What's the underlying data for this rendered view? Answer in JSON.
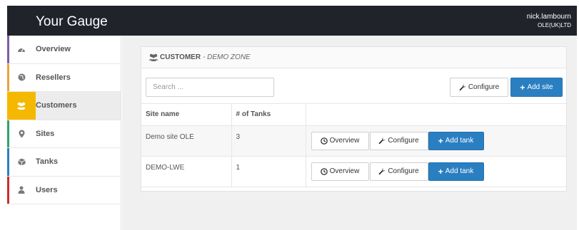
{
  "app": {
    "title": "Your Gauge"
  },
  "user": {
    "name": "nick.lambourn",
    "org": "OLE(UK)LTD"
  },
  "sidebar": {
    "items": [
      {
        "label": "Overview",
        "icon": "dashboard-icon",
        "color": "#7b5ea8"
      },
      {
        "label": "Resellers",
        "icon": "globe-icon",
        "color": "#e9a13c"
      },
      {
        "label": "Customers",
        "icon": "users-icon",
        "color": "#f5b800"
      },
      {
        "label": "Sites",
        "icon": "map-marker-icon",
        "color": "#2fa36b"
      },
      {
        "label": "Tanks",
        "icon": "cube-icon",
        "color": "#2a7fc1"
      },
      {
        "label": "Users",
        "icon": "user-icon",
        "color": "#c9302c"
      }
    ],
    "active": "Customers"
  },
  "panel": {
    "heading": "CUSTOMER",
    "subheading": "- DEMO ZONE",
    "search_placeholder": "Search ...",
    "configure_label": "Configure",
    "add_site_label": "Add site",
    "table": {
      "columns": [
        "Site name",
        "# of Tanks",
        ""
      ],
      "rows": [
        {
          "site": "Demo site OLE",
          "tanks": "3"
        },
        {
          "site": "DEMO-LWE",
          "tanks": "1"
        }
      ],
      "row_actions": {
        "overview": "Overview",
        "configure": "Configure",
        "add_tank": "Add tank"
      }
    }
  },
  "colors": {
    "topbar": "#20232a",
    "primary": "#2a7fc1",
    "active_accent": "#f5b800"
  }
}
